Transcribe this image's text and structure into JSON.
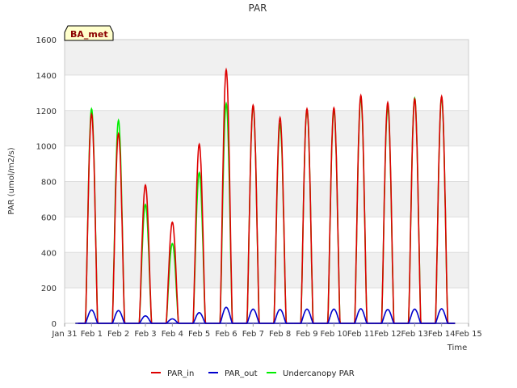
{
  "chart_data": {
    "type": "line",
    "title": "PAR",
    "xlabel": "Time",
    "ylabel": "PAR (umol/m2/s)",
    "badge": "BA_met",
    "x_tick_labels": [
      "Jan 31",
      "Feb 1",
      "Feb 2",
      "Feb 3",
      "Feb 4",
      "Feb 5",
      "Feb 6",
      "Feb 7",
      "Feb 8",
      "Feb 9",
      "Feb 10",
      "Feb 11",
      "Feb 12",
      "Feb 13",
      "Feb 14",
      "Feb 15"
    ],
    "xlim": [
      0,
      15
    ],
    "ylim": [
      0,
      1600
    ],
    "y_ticks": [
      0,
      200,
      400,
      600,
      800,
      1000,
      1200,
      1400,
      1600
    ],
    "grid": true,
    "background_bands": true,
    "legend_position": "bottom",
    "x_units": "days since Jan 31",
    "series": [
      {
        "name": "PAR_in",
        "color": "#dd0000",
        "daily_peaks": [
          {
            "day": 1,
            "peak": 1180
          },
          {
            "day": 2,
            "peak": 1070
          },
          {
            "day": 3,
            "peak": 780
          },
          {
            "day": 4,
            "peak": 570
          },
          {
            "day": 5,
            "peak": 1010
          },
          {
            "day": 6,
            "peak": 1430
          },
          {
            "day": 7,
            "peak": 1230
          },
          {
            "day": 8,
            "peak": 1160
          },
          {
            "day": 9,
            "peak": 1210
          },
          {
            "day": 10,
            "peak": 1215
          },
          {
            "day": 11,
            "peak": 1285
          },
          {
            "day": 12,
            "peak": 1245
          },
          {
            "day": 13,
            "peak": 1265
          },
          {
            "day": 14,
            "peak": 1280
          }
        ]
      },
      {
        "name": "PAR_out",
        "color": "#0000cc",
        "daily_peaks": [
          {
            "day": 1,
            "peak": 75
          },
          {
            "day": 2,
            "peak": 72
          },
          {
            "day": 3,
            "peak": 42
          },
          {
            "day": 4,
            "peak": 25
          },
          {
            "day": 5,
            "peak": 60
          },
          {
            "day": 6,
            "peak": 90
          },
          {
            "day": 7,
            "peak": 80
          },
          {
            "day": 8,
            "peak": 78
          },
          {
            "day": 9,
            "peak": 80
          },
          {
            "day": 10,
            "peak": 80
          },
          {
            "day": 11,
            "peak": 82
          },
          {
            "day": 12,
            "peak": 78
          },
          {
            "day": 13,
            "peak": 80
          },
          {
            "day": 14,
            "peak": 82
          }
        ]
      },
      {
        "name": "Undercanopy PAR",
        "color": "#00ee00",
        "daily_peaks": [
          {
            "day": 1,
            "peak": 1210
          },
          {
            "day": 2,
            "peak": 1145
          },
          {
            "day": 3,
            "peak": 670
          },
          {
            "day": 4,
            "peak": 450
          },
          {
            "day": 5,
            "peak": 850
          },
          {
            "day": 6,
            "peak": 1240
          },
          {
            "day": 7,
            "peak": 1225
          },
          {
            "day": 8,
            "peak": 1120
          },
          {
            "day": 9,
            "peak": 1205
          },
          {
            "day": 10,
            "peak": 1200
          },
          {
            "day": 11,
            "peak": 1270
          },
          {
            "day": 12,
            "peak": 1220
          },
          {
            "day": 13,
            "peak": 1270
          },
          {
            "day": 14,
            "peak": 1270
          }
        ]
      }
    ]
  }
}
